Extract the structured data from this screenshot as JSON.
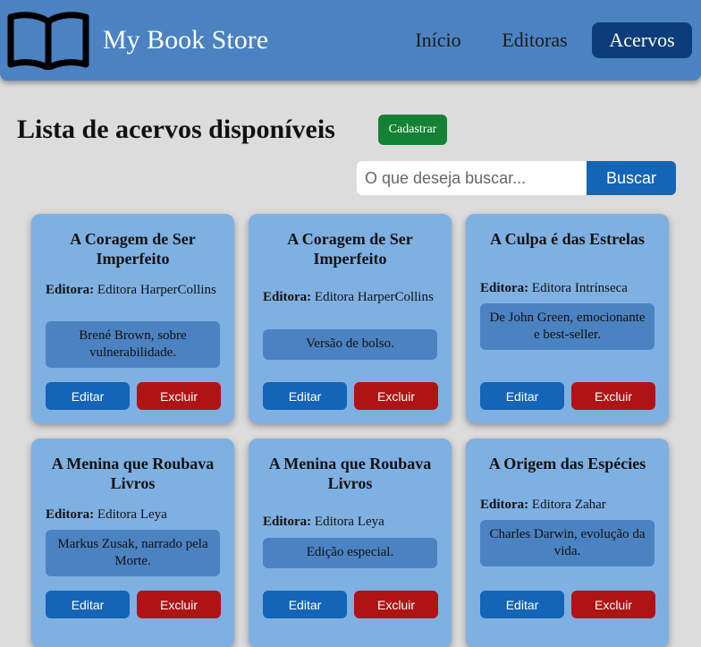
{
  "header": {
    "brand": "My Book Store",
    "nav": [
      {
        "label": "Início"
      },
      {
        "label": "Editoras"
      },
      {
        "label": "Acervos"
      }
    ]
  },
  "main": {
    "title": "Lista de acervos disponíveis",
    "cadastrar_label": "Cadastrar",
    "search": {
      "placeholder": "O que deseja buscar...",
      "button_label": "Buscar"
    },
    "publisher_label": "Editora:",
    "edit_label": "Editar",
    "delete_label": "Excluir",
    "cards": [
      {
        "title": "A Coragem de Ser Imperfeito",
        "publisher": "Editora HarperCollins",
        "description": "Brené Brown, sobre vulnerabilidade."
      },
      {
        "title": "A Coragem de Ser Imperfeito",
        "publisher": "Editora HarperCollins",
        "description": "Versão de bolso."
      },
      {
        "title": "A Culpa é das Estrelas",
        "publisher": "Editora Intrínseca",
        "description": "De John Green, emocionante e best-seller."
      },
      {
        "title": "A Menina que Roubava Livros",
        "publisher": "Editora Leya",
        "description": "Markus Zusak, narrado pela Morte."
      },
      {
        "title": "A Menina que Roubava Livros",
        "publisher": "Editora Leya",
        "description": "Edição especial."
      },
      {
        "title": "A Origem das Espécies",
        "publisher": "Editora Zahar",
        "description": "Charles Darwin, evolução da vida."
      }
    ]
  },
  "colors": {
    "header": "#4b82c1",
    "active_nav": "#0b3d7a",
    "card": "#7fb0e2",
    "card_desc": "#4b82c1",
    "primary": "#1464b8",
    "danger": "#b01313",
    "success": "#158134"
  },
  "icons": {
    "logo": "open-book-icon"
  }
}
